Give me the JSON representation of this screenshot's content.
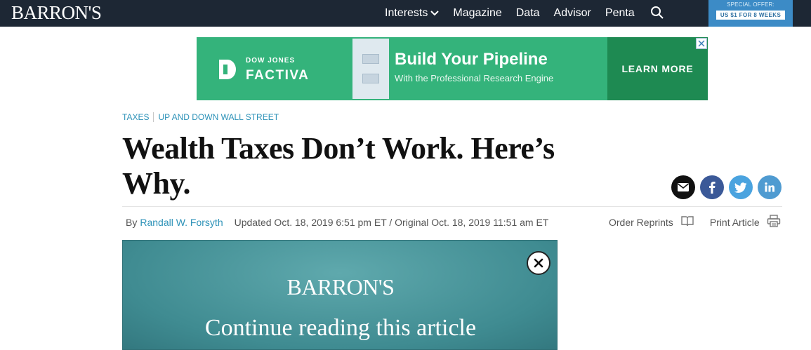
{
  "header": {
    "logo": "BARRON'S",
    "nav": [
      {
        "label": "Interests",
        "has_dropdown": true
      },
      {
        "label": "Magazine"
      },
      {
        "label": "Data"
      },
      {
        "label": "Advisor"
      },
      {
        "label": "Penta"
      }
    ],
    "search_icon": "search-icon",
    "offer": {
      "title": "SPECIAL OFFER:",
      "button": "US $1 FOR 8 WEEKS"
    }
  },
  "ad": {
    "brand_top": "DOW JONES",
    "brand_main": "FACTIVA",
    "headline": "Build Your Pipeline",
    "subhead": "With the Professional Research Engine",
    "cta": "LEARN MORE",
    "close_icon": "close-icon"
  },
  "article": {
    "breadcrumbs": [
      "TAXES",
      "UP AND DOWN WALL STREET"
    ],
    "headline_line1": "Wealth Taxes Don’t Work. Here’s",
    "headline_line2": "Why.",
    "by": "By",
    "author": "Randall W. Forsyth",
    "dates": "Updated Oct. 18, 2019 6:51 pm ET / Original Oct. 18, 2019 11:51 am ET",
    "tools": {
      "reprints": "Order Reprints",
      "print": "Print Article"
    },
    "share": [
      {
        "name": "email",
        "color": "#111111"
      },
      {
        "name": "facebook",
        "color": "#3b5998"
      },
      {
        "name": "twitter",
        "color": "#4aa3df"
      },
      {
        "name": "linkedin",
        "color": "#4f9bd1"
      }
    ]
  },
  "paywall": {
    "logo": "BARRON'S",
    "message": "Continue reading this article"
  },
  "colors": {
    "nav_bg": "#1d2734",
    "accent": "#2d92b8",
    "ad_green": "#34b37b",
    "paywall_teal": "#4f9aa0"
  }
}
